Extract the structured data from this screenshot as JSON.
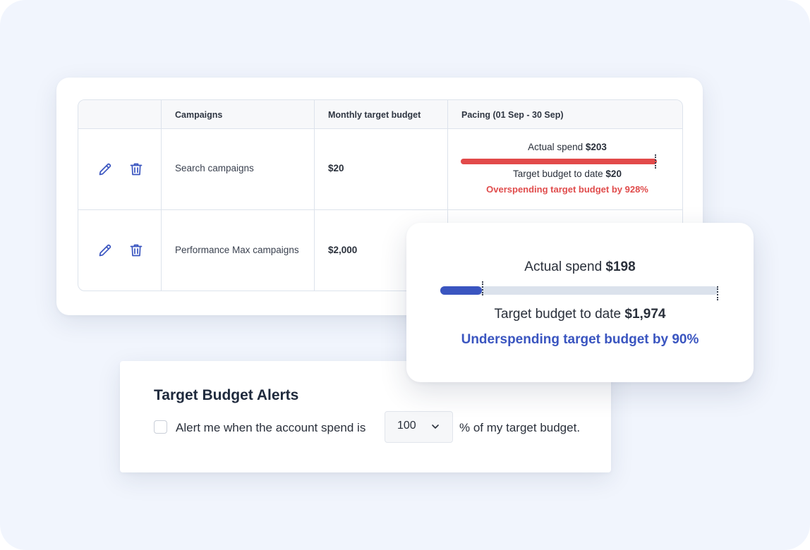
{
  "table": {
    "headers": [
      "",
      "Campaigns",
      "Monthly target budget",
      "Pacing (01 Sep - 30 Sep)"
    ],
    "rows": [
      {
        "campaign": "Search campaigns",
        "budget": "$20",
        "pacing": {
          "actual_label": "Actual spend",
          "actual_value": "$203",
          "target_label": "Target budget to date",
          "target_value": "$20",
          "status": "Overspending target budget by 928%",
          "spend_fraction": 1.0,
          "target_fraction": 0.99,
          "bar_color": "#e24a4a"
        }
      },
      {
        "campaign": "Performance Max campaigns",
        "budget": "$2,000"
      }
    ],
    "icons": {
      "edit": "pencil-icon",
      "delete": "trash-icon",
      "color": "#3a55c0"
    }
  },
  "popup": {
    "actual_label": "Actual spend",
    "actual_value": "$198",
    "target_label": "Target budget to date",
    "target_value": "$1,974",
    "status": "Underspending target budget by 90%",
    "spend_fraction": 0.15,
    "target_fraction": 1.0,
    "bar_color": "#3a55c0",
    "status_color": "#3a55c0"
  },
  "alerts": {
    "title": "Target Budget Alerts",
    "text_before": "Alert me when the account spend is",
    "select_value": "100",
    "text_after": "% of my target budget.",
    "checked": false
  }
}
